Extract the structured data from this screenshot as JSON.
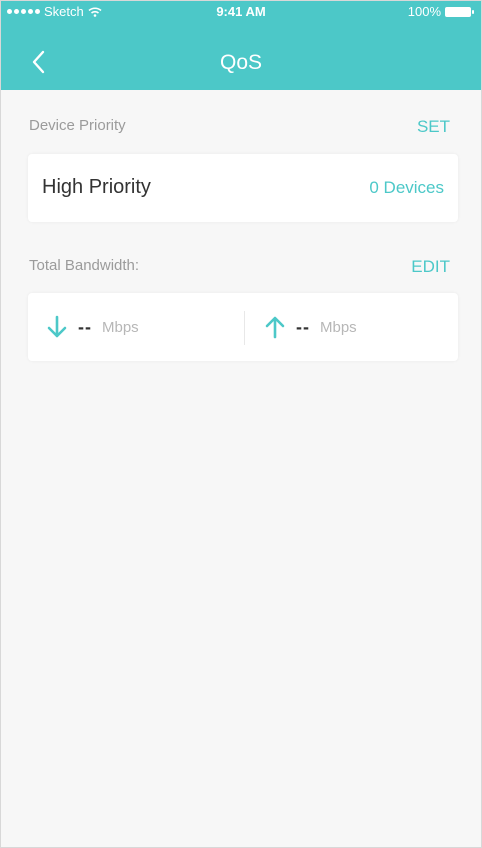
{
  "status_bar": {
    "carrier": "Sketch",
    "time": "9:41 AM",
    "battery": "100%"
  },
  "nav": {
    "title": "QoS",
    "back_icon": "chevron-left-icon"
  },
  "device_priority": {
    "label": "Device Priority",
    "action": "SET",
    "card_title": "High Priority",
    "count": "0 Devices"
  },
  "bandwidth": {
    "label": "Total Bandwidth:",
    "action": "EDIT",
    "download_value": "--",
    "download_unit": "Mbps",
    "upload_value": "--",
    "upload_unit": "Mbps",
    "download_icon": "arrow-down-icon",
    "upload_icon": "arrow-up-icon"
  },
  "colors": {
    "accent": "#4cc8c8",
    "background": "#f7f7f7",
    "text": "#333333",
    "muted": "#9b9b9b"
  }
}
